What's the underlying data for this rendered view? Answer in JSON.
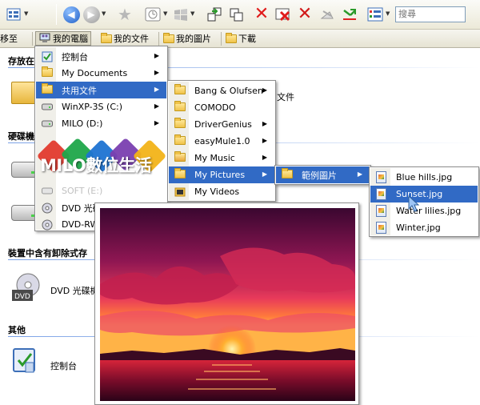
{
  "toolbar": {
    "icons": [
      "views-icon",
      "back-icon",
      "forward-icon",
      "favorites-icon",
      "history-icon",
      "windows-icon",
      "move-to-icon",
      "copy-to-icon",
      "delete-icon",
      "delete-file-icon",
      "delete-red-icon",
      "undo-icon",
      "arrow-icon",
      "properties-icon"
    ],
    "search_placeholder": "搜尋"
  },
  "links_bar": {
    "move_label": "移至",
    "items": [
      "我的電腦",
      "我的文件",
      "我的圖片",
      "下載"
    ],
    "active": "我的電腦"
  },
  "explorer": {
    "sections": [
      "存放在",
      "硬碟機",
      "裝置中含有卸除式存",
      "其他"
    ],
    "partial_labels": [
      "文件"
    ],
    "dvd_label": "DVD 光碟機",
    "control_panel_label": "控制台"
  },
  "menu_computer": {
    "items": [
      {
        "label": "控制台",
        "icon": "control-panel-icon",
        "submenu": true
      },
      {
        "label": "My Documents",
        "icon": "folder-icon",
        "submenu": true
      },
      {
        "label": "共用文件",
        "icon": "folder-icon",
        "submenu": true,
        "selected": true
      },
      {
        "label": "WinXP-3S (C:)",
        "icon": "drive-icon",
        "submenu": true
      },
      {
        "label": "MILO (D:)",
        "icon": "drive-icon",
        "submenu": true
      },
      {
        "label": "SOFT (E:)",
        "icon": "drive-icon",
        "submenu": false
      },
      {
        "label": "DVD 光碟機",
        "icon": "dvd-drive-icon",
        "submenu": false
      },
      {
        "label": "DVD-RW",
        "icon": "dvd-drive-icon",
        "submenu": false
      }
    ]
  },
  "menu_shared": {
    "items": [
      {
        "label": "Bang & Olufsen",
        "submenu": true
      },
      {
        "label": "COMODO",
        "submenu": false
      },
      {
        "label": "DriverGenius",
        "submenu": true
      },
      {
        "label": "easyMule1.0",
        "submenu": true
      },
      {
        "label": "My Music",
        "submenu": true
      },
      {
        "label": "My Pictures",
        "submenu": true,
        "selected": true
      },
      {
        "label": "My Videos",
        "submenu": false
      }
    ]
  },
  "menu_pictures": {
    "items": [
      {
        "label": "範例圖片",
        "submenu": true,
        "selected": true
      }
    ]
  },
  "menu_samples": {
    "items": [
      {
        "label": "Blue hills.jpg"
      },
      {
        "label": "Sunset.jpg",
        "selected": true
      },
      {
        "label": "Water lilies.jpg"
      },
      {
        "label": "Winter.jpg"
      }
    ]
  },
  "logo_text": "MILO數位生活",
  "colors": {
    "menu_highlight": "#316ac5",
    "toolbar_bg": "#ece9d8",
    "section_rule": "#7aa1e6"
  }
}
